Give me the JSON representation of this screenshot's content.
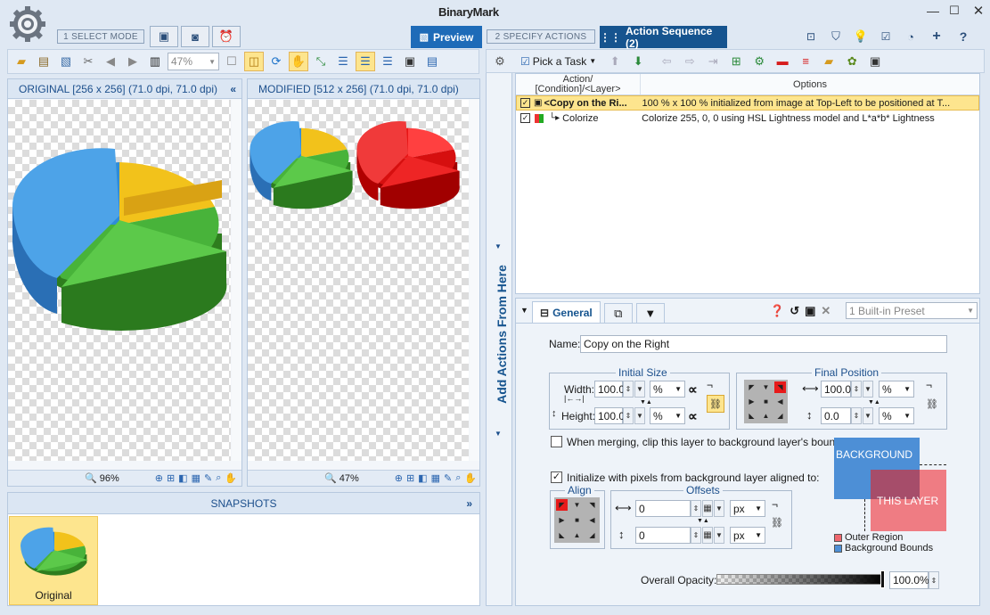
{
  "app": {
    "title": "BinaryMark"
  },
  "modes": {
    "step1": "1 SELECT MODE",
    "preview": "Preview",
    "step2": "2 SPECIFY ACTIONS",
    "action_sequence": "Action Sequence (2)"
  },
  "left_toolbar": {
    "zoom_value": "47%"
  },
  "original": {
    "header": "ORIGINAL [256 x 256] (71.0 dpi, 71.0 dpi)",
    "zoom": "96%"
  },
  "modified": {
    "header": "MODIFIED [512 x 256] (71.0 dpi, 71.0 dpi)",
    "zoom": "47%"
  },
  "snapshots": {
    "header": "SNAPSHOTS",
    "items": [
      {
        "label": "Original"
      }
    ]
  },
  "side_tab": {
    "label": "Add Actions From Here"
  },
  "right_toolbar": {
    "pick_task": "Pick a Task"
  },
  "actions_table": {
    "col_action": "Action/\n[Condition]/<Layer>",
    "col_options": "Options",
    "rows": [
      {
        "action": "<Copy on the Ri...",
        "options": "100 % x 100 % initialized from image at Top-Left to be positioned at T..."
      },
      {
        "action": "Colorize",
        "options": "Colorize 255, 0, 0 using HSL Lightness model and L*a*b* Lightness"
      }
    ]
  },
  "settings": {
    "tab_general": "General",
    "preset": "1 Built-in Preset",
    "name_label": "Name:",
    "name_value": "Copy on the Right",
    "initial_size": {
      "title": "Initial Size",
      "width_label": "Width:",
      "width_value": "100.0",
      "width_unit": "%",
      "height_label": "Height:",
      "height_value": "100.0",
      "height_unit": "%"
    },
    "final_position": {
      "title": "Final Position",
      "x_value": "100.0",
      "x_unit": "%",
      "y_value": "0.0",
      "y_unit": "%"
    },
    "clip_label": "When merging, clip this layer to background layer's bounds",
    "init_label": "Initialize with pixels from background layer aligned to:",
    "align_title": "Align",
    "offsets": {
      "title": "Offsets",
      "x_value": "0",
      "y_value": "0",
      "unit": "px"
    },
    "diagram": {
      "background": "BACKGROUND",
      "this_layer": "THIS LAYER",
      "legend_outer": "Outer Region",
      "legend_bounds": "Background Bounds"
    },
    "opacity_label": "Overall Opacity:",
    "opacity_value": "100.0%"
  },
  "colors": {
    "accent": "#1a6fc1",
    "dark_tab": "#16548f",
    "highlight": "#fde58e"
  }
}
